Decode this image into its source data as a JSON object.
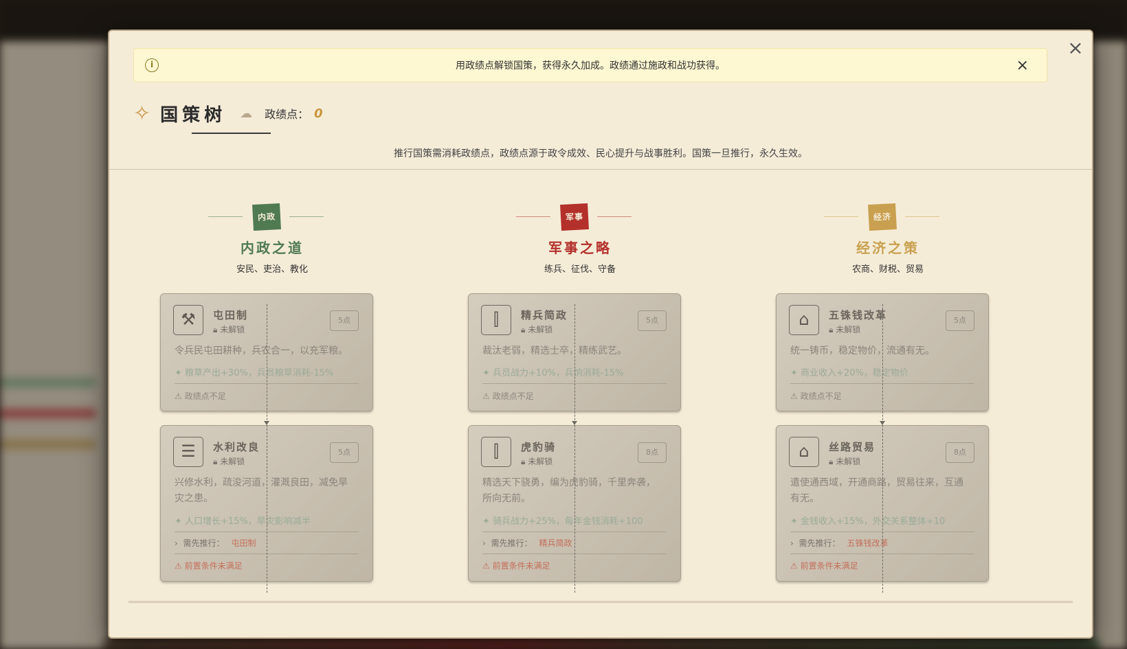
{
  "notice": {
    "text": "用政绩点解锁国策，获得永久加成。政绩通过施政和战功获得。",
    "info_icon": "info-icon",
    "close_icon": "close-icon"
  },
  "modal": {
    "close_icon": "close-icon"
  },
  "header": {
    "title": "国策树",
    "points_label": "政绩点：",
    "points_value": "0",
    "icon": "sparkle-icon",
    "cloud_icon": "cloud-icon"
  },
  "description": "推行国策需消耗政绩点，政绩点源于政令成效、民心提升与战事胜利。国策一旦推行，永久生效。",
  "columns": [
    {
      "badge": "内政",
      "title": "内政之道",
      "subtitle": "安民、吏治、教化",
      "color": "#4f7a52",
      "cards": [
        {
          "icon": "plow-icon",
          "name": "屯田制",
          "lock": "未解锁",
          "cost": "5点",
          "desc": "令兵民屯田耕种，兵农合一，以充军粮。",
          "effect": "✦ 粮草产出+30%，兵员粮草消耗-15%",
          "warn": "政绩点不足"
        },
        {
          "icon": "scroll-icon",
          "name": "水利改良",
          "lock": "未解锁",
          "cost": "5点",
          "desc": "兴修水利，疏浚河道，灌溉良田，减免旱灾之患。",
          "effect": "✦ 人口增长+15%，旱灾影响减半",
          "req_label": "需先推行：",
          "req_name": "屯田制",
          "warn": "前置条件未满足"
        }
      ]
    },
    {
      "badge": "军事",
      "title": "军事之略",
      "subtitle": "练兵、征伐、守备",
      "color": "#b3302b",
      "cards": [
        {
          "icon": "soldier-icon",
          "name": "精兵简政",
          "lock": "未解锁",
          "cost": "5点",
          "desc": "裁汰老弱，精选士卒，精练武艺。",
          "effect": "✦ 兵员战力+10%，兵饷消耗-15%",
          "warn": "政绩点不足"
        },
        {
          "icon": "soldier-icon",
          "name": "虎豹骑",
          "lock": "未解锁",
          "cost": "8点",
          "desc": "精选天下骁勇，编为虎豹骑，千里奔袭，所向无前。",
          "effect": "✦ 骑兵战力+25%，每年金钱消耗+100",
          "req_label": "需先推行：",
          "req_name": "精兵简政",
          "warn": "前置条件未满足"
        }
      ]
    },
    {
      "badge": "经济",
      "title": "经济之策",
      "subtitle": "农商、财税、贸易",
      "color": "#c9a04f",
      "cards": [
        {
          "icon": "warehouse-icon",
          "name": "五铢钱改革",
          "lock": "未解锁",
          "cost": "5点",
          "desc": "统一铸币，稳定物价，流通有无。",
          "effect": "✦ 商业收入+20%，稳定物价",
          "warn": "政绩点不足"
        },
        {
          "icon": "warehouse-icon",
          "name": "丝路贸易",
          "lock": "未解锁",
          "cost": "8点",
          "desc": "遣使通西域，开通商路，贸易往来，互通有无。",
          "effect": "✦ 金钱收入+15%，外交关系整体+10",
          "req_label": "需先推行：",
          "req_name": "五铢钱改革",
          "warn": "前置条件未满足"
        }
      ]
    }
  ]
}
